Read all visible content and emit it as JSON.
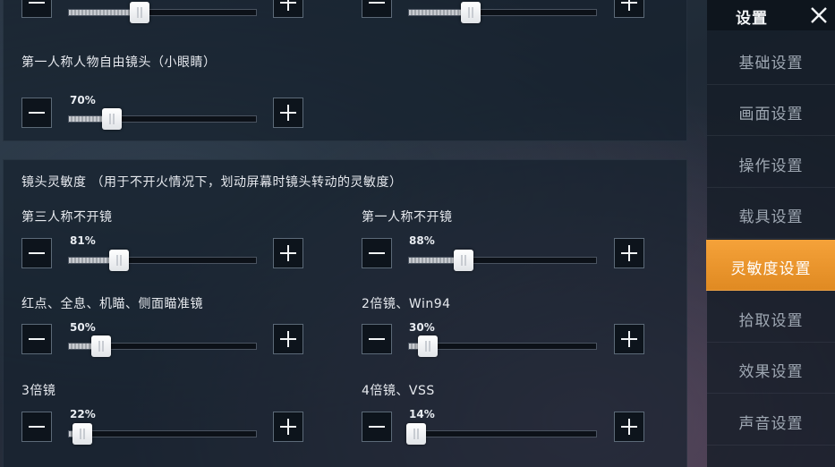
{
  "header": {
    "title": "设置"
  },
  "sidebar": {
    "items": [
      {
        "label": "基础设置"
      },
      {
        "label": "画面设置"
      },
      {
        "label": "操作设置"
      },
      {
        "label": "载具设置"
      },
      {
        "label": "灵敏度设置",
        "active": true
      },
      {
        "label": "拾取设置"
      },
      {
        "label": "效果设置"
      },
      {
        "label": "声音设置"
      }
    ]
  },
  "top": {
    "sliders_partial": [
      {
        "value": 0.38
      },
      {
        "value": 0.33
      }
    ],
    "freelook": {
      "label": "第一人称人物自由镜头（小眼睛）",
      "value": "70%",
      "fraction": 0.23
    }
  },
  "sensitivity": {
    "title": "镜头灵敏度 （用于不开火情况下，划动屏幕时镜头转动的灵敏度）",
    "settings": [
      {
        "label": "第三人称不开镜",
        "value": "81%",
        "fraction": 0.27
      },
      {
        "label": "第一人称不开镜",
        "value": "88%",
        "fraction": 0.29
      },
      {
        "label": "红点、全息、机瞄、侧面瞄准镜",
        "value": "50%",
        "fraction": 0.17
      },
      {
        "label": "2倍镜、Win94",
        "value": "30%",
        "fraction": 0.1
      },
      {
        "label": "3倍镜",
        "value": "22%",
        "fraction": 0.07
      },
      {
        "label": "4倍镜、VSS",
        "value": "14%",
        "fraction": 0.04
      }
    ]
  },
  "colors": {
    "accent": "#f09a30"
  },
  "icons": {
    "minus": "minus-icon",
    "plus": "plus-icon",
    "close": "close-icon"
  }
}
